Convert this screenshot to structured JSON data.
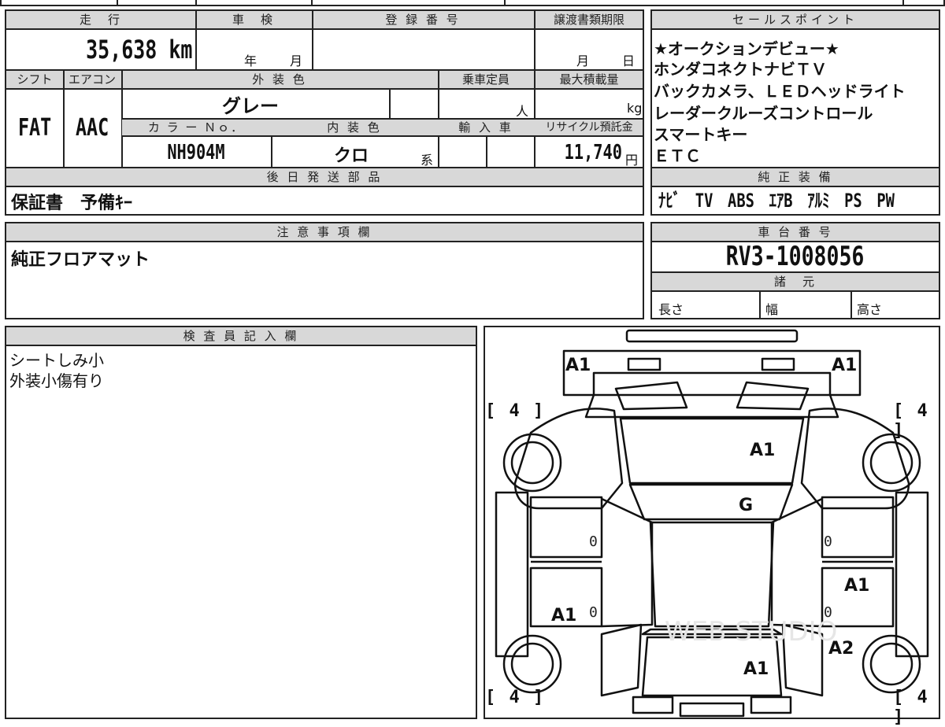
{
  "header": {
    "mileage_label": "走　行",
    "inspection_label": "車　検",
    "registration_label": "登 録 番 号",
    "transfer_deadline_label": "譲渡書類期限",
    "mileage_value": "35,638 km",
    "inspection_year": "年",
    "inspection_month": "月",
    "transfer_month": "月",
    "transfer_day": "日"
  },
  "specs": {
    "shift_label": "シフト",
    "aircon_label": "エアコン",
    "exterior_color_label": "外 装 色",
    "capacity_label": "乗車定員",
    "max_load_label": "最大積載量",
    "shift_value": "FAT",
    "aircon_value": "AAC",
    "exterior_color_value": "グレー",
    "capacity_unit": "人",
    "max_load_unit": "kg",
    "color_no_label": "カ ラ ー Ｎｏ．",
    "interior_color_label": "内 装 色",
    "import_label": "輸 入 車",
    "recycle_label": "リサイクル預託金",
    "color_no_value": "NH904M",
    "interior_color_value": "クロ",
    "interior_suffix": "系",
    "recycle_value": "11,740",
    "recycle_unit": "円"
  },
  "later_parts": {
    "label": "後 日 発 送 部 品",
    "value": "保証書　予備ｷｰ"
  },
  "sales_points": {
    "label": "セールスポイント",
    "lines": [
      "★オークションデビュー★",
      "ホンダコネクトナビＴＶ",
      "バックカメラ、ＬＥＤヘッドライト",
      "レーダークルーズコントロール",
      "スマートキー",
      "ＥＴＣ"
    ]
  },
  "equipment": {
    "label": "純 正 装 備",
    "value": "ﾅﾋﾞ　TV　ABS　ｴｱB　ｱﾙﾐ　PS　PW"
  },
  "notes": {
    "label": "注 意 事 項 欄",
    "value": "純正フロアマット"
  },
  "chassis": {
    "label": "車 台 番 号",
    "value": "RV3-1008056",
    "spec_label": "諸　元",
    "length_label": "長さ",
    "width_label": "幅",
    "height_label": "高さ"
  },
  "inspector": {
    "label": "検 査 員 記 入 欄",
    "lines": [
      "シートしみ小",
      "外装小傷有り"
    ]
  },
  "diagram": {
    "marks": {
      "front_left": "A1",
      "front_right": "A1",
      "bonnet": "A1",
      "windshield": "G",
      "right_rear_door": "A1",
      "left_rear_door": "A1",
      "right_rear_quarter": "A2",
      "rear": "A1"
    },
    "tires": {
      "front_left": "[ 4 ]",
      "front_right": "[ 4 ]",
      "rear_left": "[ 4 ]",
      "rear_right": "[ 4 ]"
    },
    "zeros": [
      "0",
      "0",
      "0",
      "0"
    ],
    "watermark": "WEB STUDIO"
  }
}
